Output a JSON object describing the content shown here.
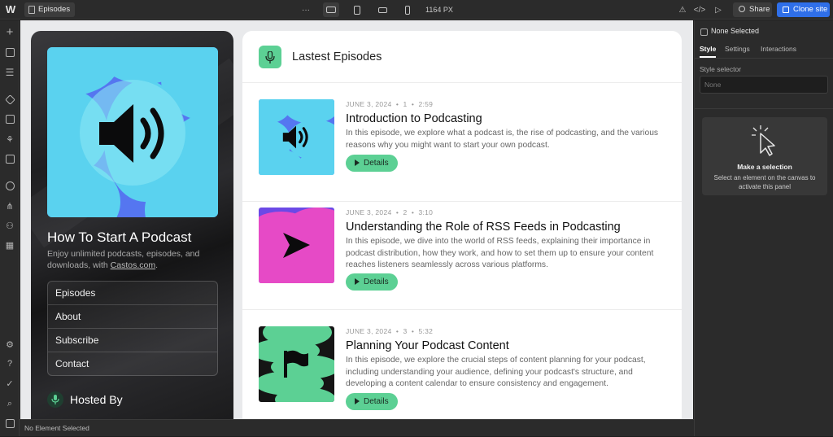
{
  "topbar": {
    "page_name": "Episodes",
    "width_value": "1164",
    "width_unit": "PX",
    "share_label": "Share",
    "clone_label": "Clone site"
  },
  "site": {
    "show_title": "How To Start A Podcast",
    "show_desc_prefix": "Enjoy unlimited podcasts, episodes, and downloads, with ",
    "show_desc_link": "Castos.com",
    "show_desc_suffix": ".",
    "nav": [
      "Episodes",
      "About",
      "Subscribe",
      "Contact"
    ],
    "hosted_by": "Hosted By",
    "section_title": "Lastest Episodes",
    "details_label": "Details",
    "episodes": [
      {
        "date": "JUNE 3, 2024",
        "number": "1",
        "duration": "2:59",
        "title": "Introduction to Podcasting",
        "description": "In this episode, we explore what a podcast is, the rise of podcasting, and the various reasons why you might want to start your own podcast.",
        "art_bg": "#5576f0",
        "art_blob": "#5ad2ef",
        "icon": "speaker-icon"
      },
      {
        "date": "JUNE 3, 2024",
        "number": "2",
        "duration": "3:10",
        "title": "Understanding the Role of RSS Feeds in Podcasting",
        "description": "In this episode, we dive into the world of RSS feeds, explaining their importance in podcast distribution, how they work, and how to set them up to ensure your content reaches listeners seamlessly across various platforms.",
        "art_bg": "#6b49e6",
        "art_blob": "#e64ac6",
        "icon": "send-icon"
      },
      {
        "date": "JUNE 3, 2024",
        "number": "3",
        "duration": "5:32",
        "title": "Planning Your Podcast Content",
        "description": "In this episode, we explore the crucial steps of content planning for your podcast, including understanding your audience, defining your podcast's structure, and developing a content calendar to ensure consistency and engagement.",
        "art_bg": "#151515",
        "art_blob": "#5cd094",
        "icon": "flag-icon"
      }
    ]
  },
  "panel": {
    "none_selected": "None Selected",
    "tabs": [
      "Style",
      "Settings",
      "Interactions"
    ],
    "style_selector_label": "Style selector",
    "style_selector_placeholder": "None",
    "selection_title": "Make a selection",
    "selection_desc": "Select an element on the canvas to activate this panel"
  },
  "status": {
    "text": "No Element Selected"
  }
}
